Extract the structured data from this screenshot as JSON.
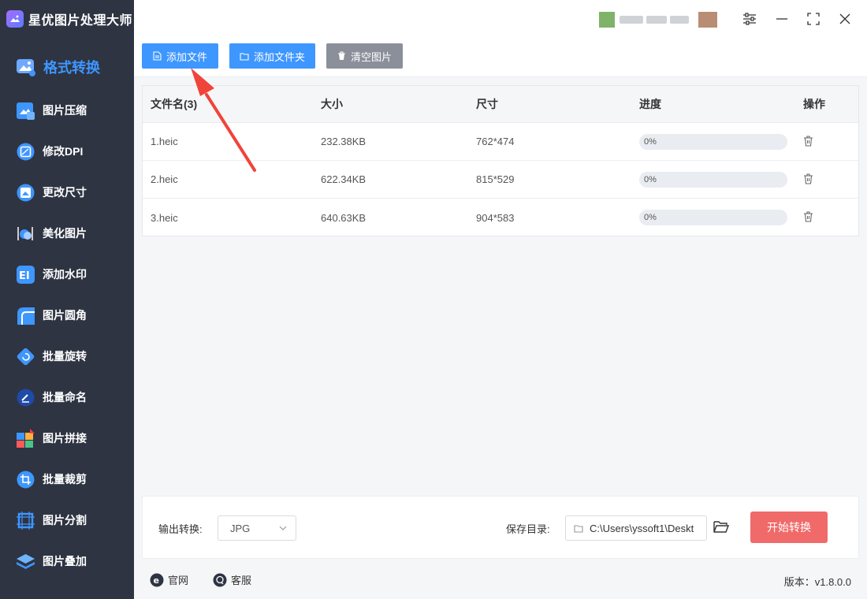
{
  "app": {
    "title": "星优图片处理大师"
  },
  "sidebar": {
    "items": [
      {
        "label": "格式转换",
        "icon": "image-convert-icon",
        "active": true
      },
      {
        "label": "图片压缩",
        "icon": "compress-icon"
      },
      {
        "label": "修改DPI",
        "icon": "dpi-icon"
      },
      {
        "label": "更改尺寸",
        "icon": "resize-icon"
      },
      {
        "label": "美化图片",
        "icon": "beautify-icon"
      },
      {
        "label": "添加水印",
        "icon": "watermark-icon"
      },
      {
        "label": "图片圆角",
        "icon": "round-corner-icon"
      },
      {
        "label": "批量旋转",
        "icon": "rotate-icon"
      },
      {
        "label": "批量命名",
        "icon": "rename-icon"
      },
      {
        "label": "图片拼接",
        "icon": "stitch-icon"
      },
      {
        "label": "批量裁剪",
        "icon": "crop-icon"
      },
      {
        "label": "图片分割",
        "icon": "split-icon"
      },
      {
        "label": "图片叠加",
        "icon": "layers-icon"
      }
    ]
  },
  "toolbar": {
    "add_file": "添加文件",
    "add_folder": "添加文件夹",
    "clear_images": "清空图片"
  },
  "table": {
    "headers": [
      "文件名(3)",
      "大小",
      "尺寸",
      "进度",
      "操作"
    ],
    "rows": [
      {
        "name": "1.heic",
        "size": "232.38KB",
        "dimensions": "762*474",
        "progress": "0%",
        "progress_value": 0
      },
      {
        "name": "2.heic",
        "size": "622.34KB",
        "dimensions": "815*529",
        "progress": "0%",
        "progress_value": 0
      },
      {
        "name": "3.heic",
        "size": "640.63KB",
        "dimensions": "904*583",
        "progress": "0%",
        "progress_value": 0
      }
    ]
  },
  "bottom": {
    "output_label": "输出转换:",
    "output_format": "JPG",
    "save_label": "保存目录:",
    "save_path": "C:\\Users\\yssoft1\\Deskt",
    "start_button": "开始转换"
  },
  "footer": {
    "website": "官网",
    "support": "客服",
    "version": "版本：v1.8.0.0"
  },
  "colors": {
    "accent": "#3e96ff",
    "sidebar_bg": "#2e3442",
    "start_button": "#f06a6a",
    "annotation_arrow": "#f0443a"
  }
}
